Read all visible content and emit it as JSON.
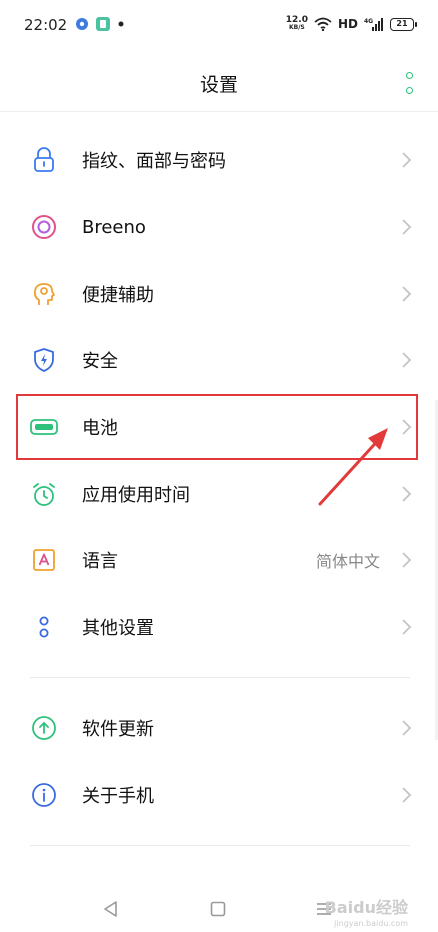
{
  "status_bar": {
    "time": "22:02",
    "net_speed_value": "12.0",
    "net_speed_unit": "KB/S",
    "hd": "HD",
    "signal_label": "4G",
    "battery": "21"
  },
  "header": {
    "title": "设置"
  },
  "settings": {
    "group1": [
      {
        "label": "指纹、面部与密码",
        "icon": "lock-icon"
      },
      {
        "label": "Breeno",
        "icon": "breeno-icon"
      },
      {
        "label": "便捷辅助",
        "icon": "assist-icon"
      },
      {
        "label": "安全",
        "icon": "shield-icon"
      },
      {
        "label": "电池",
        "icon": "battery-icon"
      },
      {
        "label": "应用使用时间",
        "icon": "alarm-clock-icon"
      },
      {
        "label": "语言",
        "icon": "language-icon",
        "value": "简体中文"
      },
      {
        "label": "其他设置",
        "icon": "other-settings-icon"
      }
    ],
    "group2": [
      {
        "label": "软件更新",
        "icon": "update-icon"
      },
      {
        "label": "关于手机",
        "icon": "info-icon"
      }
    ]
  },
  "watermark": {
    "text": "Baidu经验",
    "sub": "jingyan.baidu.com"
  },
  "colors": {
    "accent_green": "#2cc27c",
    "highlight_red": "#e23a3a"
  }
}
